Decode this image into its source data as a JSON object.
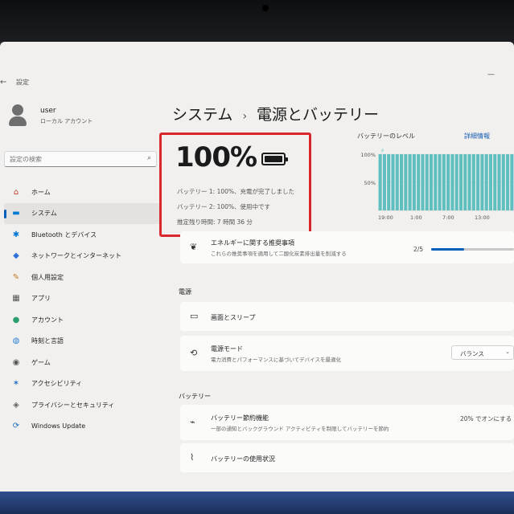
{
  "window": {
    "back_glyph": "←",
    "title": "設定",
    "minimize_glyph": "—"
  },
  "user": {
    "name": "user",
    "account_type": "ローカル アカウント"
  },
  "search": {
    "placeholder": "設定の検索",
    "icon": "search-icon"
  },
  "sidebar": {
    "items": [
      {
        "label": "ホーム",
        "icon": "home-icon",
        "glyph": "⌂",
        "color": "#c0392b"
      },
      {
        "label": "システム",
        "icon": "system-icon",
        "glyph": "▬",
        "color": "#0078d4",
        "active": true
      },
      {
        "label": "Bluetooth とデバイス",
        "icon": "bluetooth-icon",
        "glyph": "✱",
        "color": "#0078d4"
      },
      {
        "label": "ネットワークとインターネット",
        "icon": "wifi-icon",
        "glyph": "◆",
        "color": "#2e6fd8"
      },
      {
        "label": "個人用設定",
        "icon": "brush-icon",
        "glyph": "✎",
        "color": "#c77d2a"
      },
      {
        "label": "アプリ",
        "icon": "apps-icon",
        "glyph": "▦",
        "color": "#555555"
      },
      {
        "label": "アカウント",
        "icon": "account-icon",
        "glyph": "●",
        "color": "#2e9e6f"
      },
      {
        "label": "時刻と言語",
        "icon": "globe-clock-icon",
        "glyph": "◍",
        "color": "#2a7fd4"
      },
      {
        "label": "ゲーム",
        "icon": "gamepad-icon",
        "glyph": "◉",
        "color": "#555555"
      },
      {
        "label": "アクセシビリティ",
        "icon": "accessibility-icon",
        "glyph": "✶",
        "color": "#1f6fc4"
      },
      {
        "label": "プライバシーとセキュリティ",
        "icon": "shield-icon",
        "glyph": "◈",
        "color": "#666666"
      },
      {
        "label": "Windows Update",
        "icon": "windows-update-icon",
        "glyph": "⟳",
        "color": "#1f6fc4"
      }
    ]
  },
  "breadcrumb": {
    "parent": "システム",
    "separator": "›",
    "current": "電源とバッテリー"
  },
  "battery_status": {
    "percent_text": "100%",
    "icon": "battery-full-icon",
    "lines": [
      "バッテリー 1: 100%、充電が完了しました",
      "バッテリー 2: 100%、使用中です",
      "推定残り時間: 7 時間 36 分"
    ]
  },
  "battery_level": {
    "title": "バッテリーのレベル",
    "detail_link": "詳細情報",
    "charging_glyph": "⚡",
    "chart_data": {
      "type": "bar",
      "title": "",
      "ylabel": "",
      "ylim": [
        0,
        100
      ],
      "yticks": [
        "100%",
        "50%"
      ],
      "xticks": [
        "19:00",
        "1:00",
        "7:00",
        "13:00"
      ],
      "values": [
        100,
        100,
        100,
        100,
        100,
        100,
        100,
        100,
        100,
        100,
        100,
        100,
        100,
        100,
        100,
        100,
        100,
        100,
        100,
        100,
        100,
        100,
        100,
        100,
        100,
        100,
        100,
        100,
        100,
        100,
        100,
        100
      ],
      "grid": true,
      "bar_color": "#5fbfbf"
    }
  },
  "energy_recommendations": {
    "icon": "leaf-icon",
    "title": "エネルギーに関する推奨事項",
    "subtitle": "これらの推奨事項を適用して二酸化炭素排出量を削減する",
    "progress_text": "2/5",
    "progress_fraction": 0.4
  },
  "power_section": {
    "header": "電源",
    "screen_sleep": {
      "icon": "screen-sleep-icon",
      "title": "画面とスリープ"
    },
    "power_mode": {
      "icon": "power-mode-icon",
      "title": "電源モード",
      "subtitle": "電力消費とパフォーマンスに基づいてデバイスを最適化",
      "selected": "バランス"
    }
  },
  "battery_section": {
    "header": "バッテリー",
    "saver": {
      "icon": "battery-saver-icon",
      "title": "バッテリー節約機能",
      "subtitle": "一部の通知とバックグラウンド アクティビティを制限してバッテリーを節約",
      "status": "20% でオンにする"
    },
    "usage": {
      "icon": "chart-icon",
      "title": "バッテリーの使用状況"
    }
  }
}
